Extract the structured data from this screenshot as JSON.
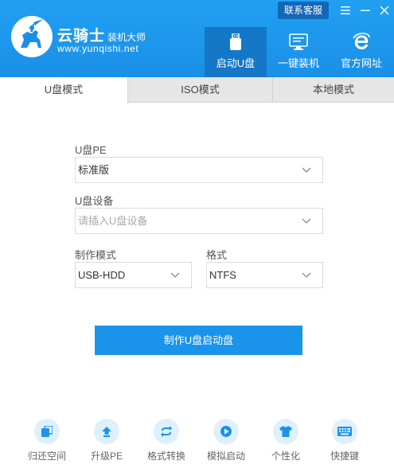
{
  "app": {
    "title": "云骑士",
    "subtitle": "装机大师",
    "url": "www.yunqishi.net"
  },
  "titlebar": {
    "contact_label": "联系客服"
  },
  "nav": {
    "items": [
      {
        "label": "启动U盘",
        "icon": "usb-drive-icon",
        "active": true
      },
      {
        "label": "一键装机",
        "icon": "monitor-icon",
        "active": false
      },
      {
        "label": "官方网址",
        "icon": "ie-browser-icon",
        "active": false
      }
    ]
  },
  "tabs": [
    {
      "label": "U盘模式",
      "active": true
    },
    {
      "label": "ISO模式",
      "active": false
    },
    {
      "label": "本地模式",
      "active": false
    }
  ],
  "form": {
    "pe_label": "U盘PE",
    "pe_value": "标准版",
    "device_label": "U盘设备",
    "device_placeholder": "请插入U盘设备",
    "mode_label": "制作模式",
    "mode_value": "USB-HDD",
    "format_label": "格式",
    "format_value": "NTFS",
    "make_button": "制作U盘启动盘"
  },
  "tools": [
    {
      "label": "归还空间",
      "icon": "restore-space-icon"
    },
    {
      "label": "升级PE",
      "icon": "upgrade-icon"
    },
    {
      "label": "格式转换",
      "icon": "convert-icon"
    },
    {
      "label": "模拟启动",
      "icon": "play-icon"
    },
    {
      "label": "个性化",
      "icon": "shirt-icon"
    },
    {
      "label": "快捷键",
      "icon": "keyboard-icon"
    }
  ],
  "colors": {
    "header_blue": "#1a8fe6",
    "active_nav": "#1477c8",
    "primary_button": "#1a94ea",
    "tool_circle_bg": "#dff0fc",
    "tool_icon": "#1a94ea"
  }
}
